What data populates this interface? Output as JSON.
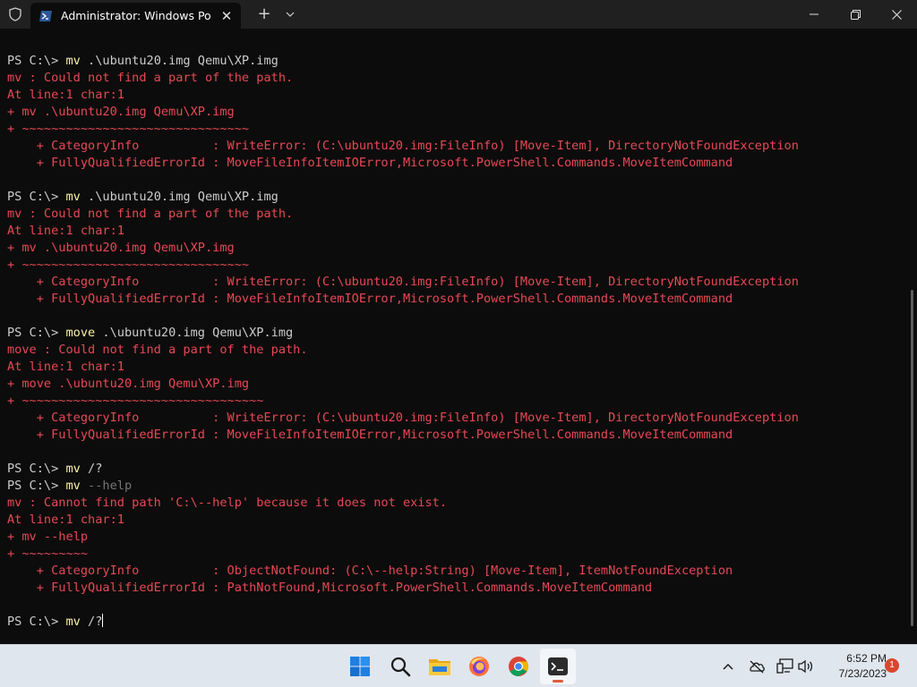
{
  "window": {
    "tab_title": "Administrator: Windows PowerShell"
  },
  "terminal": {
    "lines": [
      {
        "parts": [
          {
            "t": "PS C:\\> ",
            "c": "prompt"
          },
          {
            "t": "mv",
            "c": "cmd"
          },
          {
            "t": " .\\ubuntu20.img Qemu\\XP.img",
            "c": "prompt"
          }
        ]
      },
      {
        "parts": [
          {
            "t": "mv : Could not find a part of the path.",
            "c": "err"
          }
        ]
      },
      {
        "parts": [
          {
            "t": "At line:1 char:1",
            "c": "err"
          }
        ]
      },
      {
        "parts": [
          {
            "t": "+ mv .\\ubuntu20.img Qemu\\XP.img",
            "c": "err"
          }
        ]
      },
      {
        "parts": [
          {
            "t": "+ ~~~~~~~~~~~~~~~~~~~~~~~~~~~~~~~",
            "c": "err"
          }
        ]
      },
      {
        "parts": [
          {
            "t": "    + CategoryInfo          : WriteError: (C:\\ubuntu20.img:FileInfo) [Move-Item], DirectoryNotFoundException",
            "c": "err"
          }
        ]
      },
      {
        "parts": [
          {
            "t": "    + FullyQualifiedErrorId : MoveFileInfoItemIOError,Microsoft.PowerShell.Commands.MoveItemCommand",
            "c": "err"
          }
        ]
      },
      {
        "parts": [
          {
            "t": "",
            "c": "prompt"
          }
        ]
      },
      {
        "parts": [
          {
            "t": "PS C:\\> ",
            "c": "prompt"
          },
          {
            "t": "mv",
            "c": "cmd"
          },
          {
            "t": " .\\ubuntu20.img Qemu\\XP.img",
            "c": "prompt"
          }
        ]
      },
      {
        "parts": [
          {
            "t": "mv : Could not find a part of the path.",
            "c": "err"
          }
        ]
      },
      {
        "parts": [
          {
            "t": "At line:1 char:1",
            "c": "err"
          }
        ]
      },
      {
        "parts": [
          {
            "t": "+ mv .\\ubuntu20.img Qemu\\XP.img",
            "c": "err"
          }
        ]
      },
      {
        "parts": [
          {
            "t": "+ ~~~~~~~~~~~~~~~~~~~~~~~~~~~~~~~",
            "c": "err"
          }
        ]
      },
      {
        "parts": [
          {
            "t": "    + CategoryInfo          : WriteError: (C:\\ubuntu20.img:FileInfo) [Move-Item], DirectoryNotFoundException",
            "c": "err"
          }
        ]
      },
      {
        "parts": [
          {
            "t": "    + FullyQualifiedErrorId : MoveFileInfoItemIOError,Microsoft.PowerShell.Commands.MoveItemCommand",
            "c": "err"
          }
        ]
      },
      {
        "parts": [
          {
            "t": "",
            "c": "prompt"
          }
        ]
      },
      {
        "parts": [
          {
            "t": "PS C:\\> ",
            "c": "prompt"
          },
          {
            "t": "move",
            "c": "cmd"
          },
          {
            "t": " .\\ubuntu20.img Qemu\\XP.img",
            "c": "prompt"
          }
        ]
      },
      {
        "parts": [
          {
            "t": "move : Could not find a part of the path.",
            "c": "err"
          }
        ]
      },
      {
        "parts": [
          {
            "t": "At line:1 char:1",
            "c": "err"
          }
        ]
      },
      {
        "parts": [
          {
            "t": "+ move .\\ubuntu20.img Qemu\\XP.img",
            "c": "err"
          }
        ]
      },
      {
        "parts": [
          {
            "t": "+ ~~~~~~~~~~~~~~~~~~~~~~~~~~~~~~~~~",
            "c": "err"
          }
        ]
      },
      {
        "parts": [
          {
            "t": "    + CategoryInfo          : WriteError: (C:\\ubuntu20.img:FileInfo) [Move-Item], DirectoryNotFoundException",
            "c": "err"
          }
        ]
      },
      {
        "parts": [
          {
            "t": "    + FullyQualifiedErrorId : MoveFileInfoItemIOError,Microsoft.PowerShell.Commands.MoveItemCommand",
            "c": "err"
          }
        ]
      },
      {
        "parts": [
          {
            "t": "",
            "c": "prompt"
          }
        ]
      },
      {
        "parts": [
          {
            "t": "PS C:\\> ",
            "c": "prompt"
          },
          {
            "t": "mv",
            "c": "cmd"
          },
          {
            "t": " /?",
            "c": "prompt"
          }
        ]
      },
      {
        "parts": [
          {
            "t": "PS C:\\> ",
            "c": "prompt"
          },
          {
            "t": "mv",
            "c": "cmd"
          },
          {
            "t": " --help",
            "c": "param"
          }
        ]
      },
      {
        "parts": [
          {
            "t": "mv : Cannot find path 'C:\\--help' because it does not exist.",
            "c": "err"
          }
        ]
      },
      {
        "parts": [
          {
            "t": "At line:1 char:1",
            "c": "err"
          }
        ]
      },
      {
        "parts": [
          {
            "t": "+ mv --help",
            "c": "err"
          }
        ]
      },
      {
        "parts": [
          {
            "t": "+ ~~~~~~~~~",
            "c": "err"
          }
        ]
      },
      {
        "parts": [
          {
            "t": "    + CategoryInfo          : ObjectNotFound: (C:\\--help:String) [Move-Item], ItemNotFoundException",
            "c": "err"
          }
        ]
      },
      {
        "parts": [
          {
            "t": "    + FullyQualifiedErrorId : PathNotFound,Microsoft.PowerShell.Commands.MoveItemCommand",
            "c": "err"
          }
        ]
      },
      {
        "parts": [
          {
            "t": "",
            "c": "prompt"
          }
        ]
      },
      {
        "parts": [
          {
            "t": "PS C:\\> ",
            "c": "prompt"
          },
          {
            "t": "mv",
            "c": "cmd"
          },
          {
            "t": " /?",
            "c": "prompt"
          }
        ],
        "cursor": true
      }
    ]
  },
  "taskbar": {
    "apps": [
      {
        "name": "start-button",
        "icon": "windows-logo-icon"
      },
      {
        "name": "search-button",
        "icon": "search-icon"
      },
      {
        "name": "file-explorer-button",
        "icon": "folder-icon"
      },
      {
        "name": "firefox-button",
        "icon": "firefox-icon"
      },
      {
        "name": "chrome-button",
        "icon": "chrome-icon"
      },
      {
        "name": "terminal-button",
        "icon": "terminal-icon",
        "active": true
      }
    ],
    "time": "6:52 PM",
    "date": "7/23/2023",
    "notification_count": "1"
  },
  "colors": {
    "terminal_bg": "#0c0c0c",
    "text": "#cccccc",
    "error": "#e74856",
    "command": "#f9f1a5",
    "parameter": "#767676",
    "titlebar_bg": "#202020",
    "taskbar_bg": "#dfe6ee"
  }
}
